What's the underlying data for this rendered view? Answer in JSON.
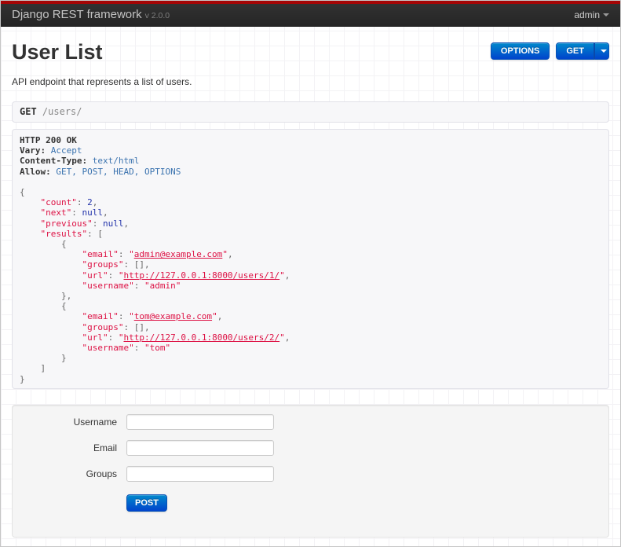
{
  "colors": {
    "accent_red": "#a30505",
    "primary_button_top": "#0088cc",
    "primary_button_bottom": "#0044cc",
    "json_string": "#dd1144",
    "json_literal": "#2233aa",
    "header_value_blue": "#3b73af"
  },
  "navbar": {
    "brand": "Django REST framework",
    "version": "v 2.0.0",
    "user_menu": "admin"
  },
  "page": {
    "title": "User List",
    "description": "API endpoint that represents a list of users."
  },
  "toolbar": {
    "options_label": "OPTIONS",
    "get_label": "GET"
  },
  "request": {
    "method": "GET",
    "path": "/users/"
  },
  "response": {
    "status_line": "HTTP 200 OK",
    "headers": [
      {
        "name": "Vary",
        "value": "Accept"
      },
      {
        "name": "Content-Type",
        "value": "text/html"
      },
      {
        "name": "Allow",
        "value": "GET, POST, HEAD, OPTIONS"
      }
    ],
    "body": {
      "count": 2,
      "next": null,
      "previous": null,
      "results": [
        {
          "email": "admin@example.com",
          "groups": [],
          "url": "http://127.0.0.1:8000/users/1/",
          "username": "admin"
        },
        {
          "email": "tom@example.com",
          "groups": [],
          "url": "http://127.0.0.1:8000/users/2/",
          "username": "tom"
        }
      ]
    }
  },
  "form": {
    "fields": [
      {
        "label": "Username",
        "value": "",
        "placeholder": ""
      },
      {
        "label": "Email",
        "value": "",
        "placeholder": ""
      },
      {
        "label": "Groups",
        "value": "",
        "placeholder": ""
      }
    ],
    "post_label": "POST"
  }
}
